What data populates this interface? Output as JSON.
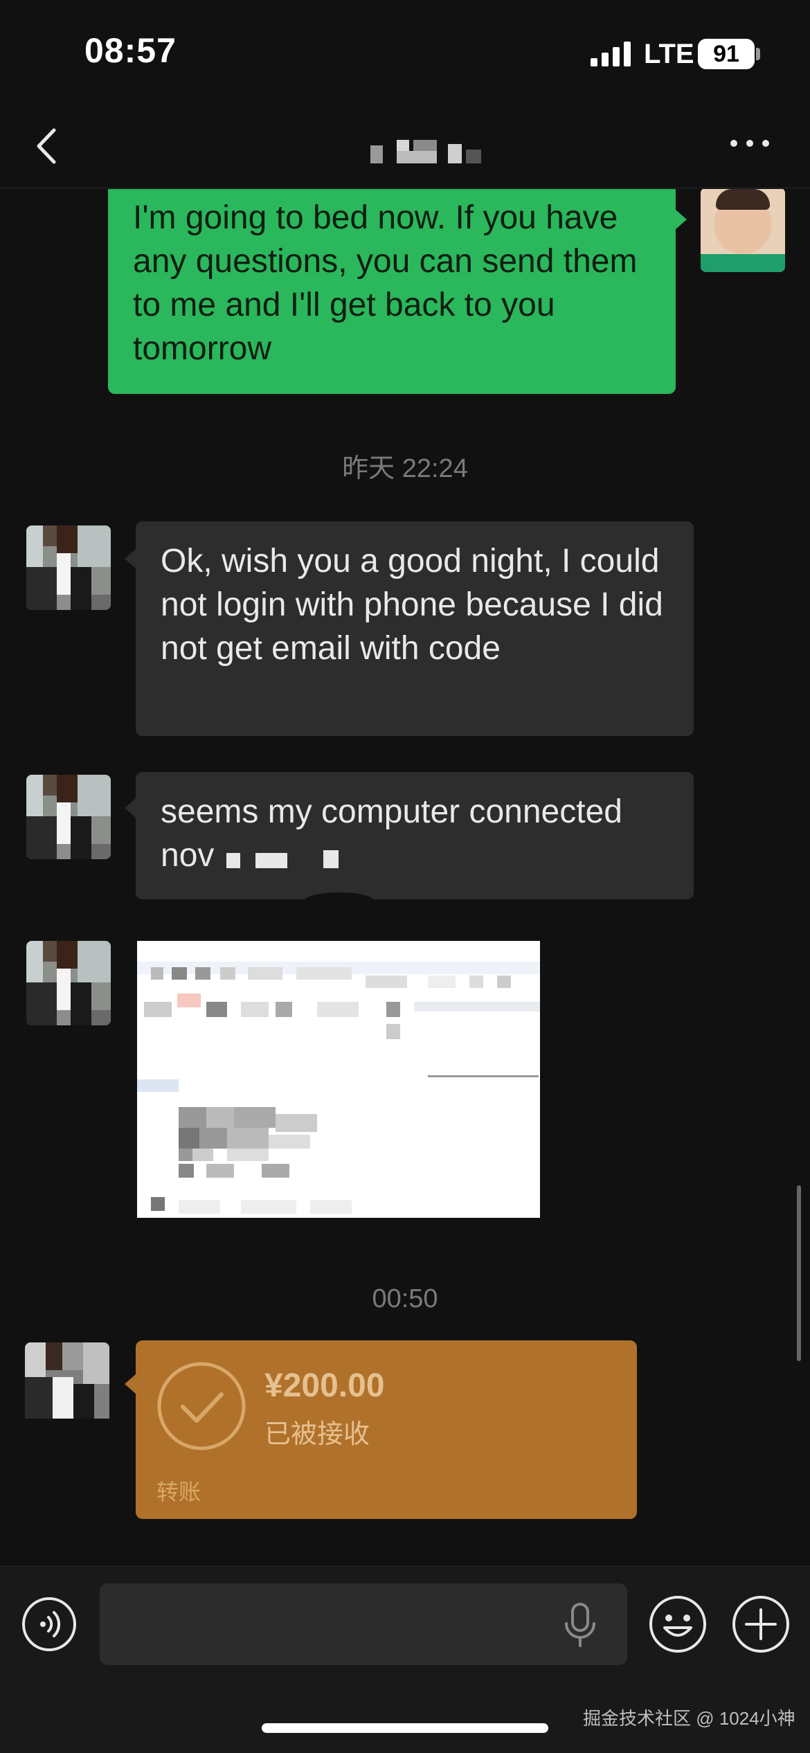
{
  "status_bar": {
    "time": "08:57",
    "network": "LTE",
    "battery": "91"
  },
  "nav": {
    "back_icon": "chevron-left-icon",
    "more_icon": "ellipsis-icon"
  },
  "messages": {
    "m1": "I'm going to bed now. If you have any questions, you can send them to me and I'll get back to you tomorrow",
    "ts1": "昨天 22:24",
    "m2": "Ok, wish you a good night, I could not login with phone because I did not get email with code",
    "m3": "seems my computer connected nov",
    "ts2": "00:50"
  },
  "transfer": {
    "amount": "¥200.00",
    "status": "已被接收",
    "label": "转账",
    "color": "#b0712b"
  },
  "input_bar": {
    "placeholder": ""
  },
  "watermark": "掘金技术社区 @ 1024小神",
  "colors": {
    "my_bubble": "#2bb75b",
    "their_bubble": "#2d2d2d",
    "background": "#111111"
  }
}
